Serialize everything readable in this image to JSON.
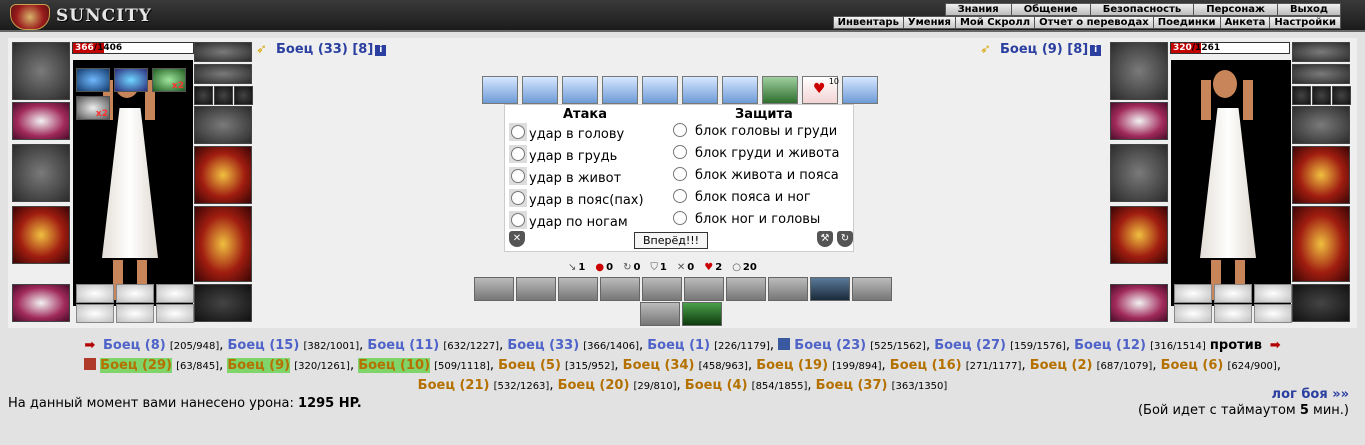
{
  "top": {
    "logo_text": "SUNCITY",
    "menu_main": [
      "Знания",
      "Общение",
      "Безопасность",
      "Персонаж",
      "Выход"
    ],
    "menu_sub": [
      "Инвентарь",
      "Умения",
      "Мой Скролл",
      "Отчет о переводах",
      "Поединки",
      "Анкета",
      "Настройки"
    ]
  },
  "left_fighter": {
    "name": "Боец (33)",
    "level": "[8]",
    "hp_current": "366",
    "hp_max": "/1406",
    "hp_fraction": 0.26,
    "buff_count": "x2",
    "buff_count2": "x2"
  },
  "right_fighter": {
    "name": "Боец (9)",
    "level": "[8]",
    "hp_current": "320",
    "hp_max": "/1261",
    "hp_fraction": 0.25
  },
  "scroll_count": "10",
  "combat": {
    "attack_title": "Атака",
    "defense_title": "Защита",
    "attacks": [
      "удар в голову",
      "удар в грудь",
      "удар в живот",
      "удар в пояс(пах)",
      "удар по ногам"
    ],
    "defenses": [
      "блок головы и груди",
      "блок груди и живота",
      "блок живота и пояса",
      "блок пояса и ног",
      "блок ног и головы"
    ],
    "go_button": "Вперёд!!!"
  },
  "stats": [
    "1",
    "0",
    "0",
    "1",
    "0",
    "2",
    "20"
  ],
  "log": {
    "team1": [
      {
        "name": "Боец (8)",
        "hp": "[205/948]"
      },
      {
        "name": "Боец (15)",
        "hp": "[382/1001]"
      },
      {
        "name": "Боец (11)",
        "hp": "[632/1227]"
      },
      {
        "name": "Боец (33)",
        "hp": "[366/1406]"
      },
      {
        "name": "Боец (1)",
        "hp": "[226/1179]"
      },
      {
        "name": "Боец (23)",
        "hp": "[525/1562]"
      },
      {
        "name": "Боец (27)",
        "hp": "[159/1576]"
      },
      {
        "name": "Боец (12)",
        "hp": "[316/1514]"
      }
    ],
    "vs": "против",
    "team2": [
      {
        "name": "Боец (29)",
        "hp": "[63/845]"
      },
      {
        "name": "Боец (9)",
        "hp": "[320/1261]"
      },
      {
        "name": "Боец (10)",
        "hp": "[509/1118]"
      },
      {
        "name": "Боец (5)",
        "hp": "[315/952]"
      },
      {
        "name": "Боец (34)",
        "hp": "[458/963]"
      },
      {
        "name": "Боец (19)",
        "hp": "[199/894]"
      },
      {
        "name": "Боец (16)",
        "hp": "[271/1177]"
      },
      {
        "name": "Боец (2)",
        "hp": "[687/1079]"
      },
      {
        "name": "Боец (6)",
        "hp": "[624/900]"
      },
      {
        "name": "Боец (21)",
        "hp": "[532/1263]"
      },
      {
        "name": "Боец (20)",
        "hp": "[29/810]"
      },
      {
        "name": "Боец (4)",
        "hp": "[854/1855]"
      },
      {
        "name": "Боец (37)",
        "hp": "[363/1350]"
      }
    ]
  },
  "footer": {
    "damage_prefix": "На данный момент вами нанесено урона: ",
    "damage_value": "1295 HP.",
    "log_link": "лог боя »»",
    "timeout_prefix": "(Бой идет с таймаутом ",
    "timeout_value": "5",
    "timeout_suffix": " мин.)"
  }
}
